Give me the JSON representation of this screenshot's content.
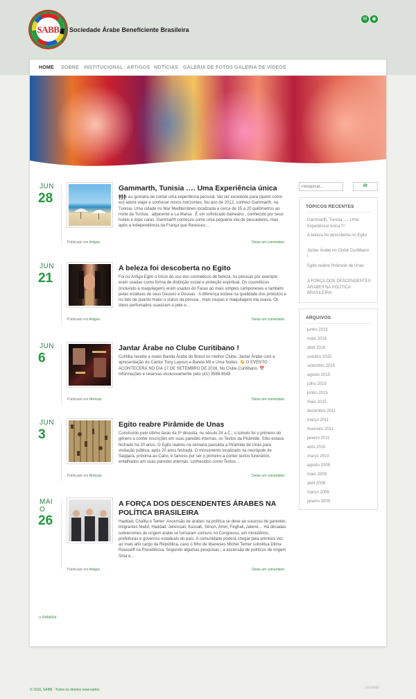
{
  "site": {
    "logo_text": "SABB",
    "title": "Sociedade Árabe Beneficiente Brasileira"
  },
  "social": [
    {
      "icon": "email-icon",
      "glyph": "✉"
    },
    {
      "icon": "rss-icon",
      "glyph": "◉"
    }
  ],
  "nav": [
    "HOME",
    "SOBRE",
    "INSTITUCIONAL",
    "ARTIGOS",
    "NOTÍCIAS",
    "GALERIA DE FOTOS",
    "GALERIA DE VÍDEOS"
  ],
  "posts": [
    {
      "month": "JUN",
      "day": "28",
      "title": "Gammarth, Tunisia …. Uma Experiência única !!!",
      "excerpt": "Hoje eu gostaria de contar uma experiência pessoal. Vai ser excelente para (quem como eu) adora viajar e conhecer novos horizontes. No ano de 2012, conheci Gammarth, na Tunisia. Uma cidade no Mar Mediterrâneo localizada a cerca de 15 a 20 quilômetros ao norte da Tunisia , adjacente a La Marsa . É um sofisticado balneário , conhecido por seus hotéis e lojas caras. Gammarth começou como uma pequena vila de pescadores, mas após a independência da França que floresceu…",
      "meta_prefix": "Publicado em",
      "category": "Artigos",
      "comment": "Deixe um comentário"
    },
    {
      "month": "JUN",
      "day": "21",
      "title": "A beleza foi descoberta no Egito",
      "excerpt": "Foi no Antigo Egito o início do uso dos cosméticos de beleza. As perucas por exemplo eram usadas como forma de distinção social e proteção espiritual. Os cosméticos (incluindo a maquilagem) eram usados do Farao ao mais simples camponeses e também pelas estátuas de seus Deuses e Deusas . A diferença estava na qualidade dos produtos e no fato de quanto maior o status da pessoa , mais roupas e maquilagem ela usava. Os óleos perfumados suavizam a pele e…",
      "meta_prefix": "Publicado em",
      "category": "Artigos",
      "comment": "Deixe um comentário"
    },
    {
      "month": "JUN",
      "day": "6",
      "title": "Jantar Árabe no Clube Curitibano !",
      "excerpt": "Curitiba recebe a maior Banda Árabe do Brasil no melhor Clube. Jantar Árabe com a apresentação do Cantor Tony Layoun e Banda Mil e Uma Noites. 👋 O EVENTO ACONTECERÁ NO DIA 17 DE SETEMBRO DE 2016, No Clube Curitibano. 📅 Informações e reservas exclusivamente pelo (41) 3598-9548",
      "meta_prefix": "Publicado em",
      "category": "Notícias",
      "comment": "Deixe um comentário"
    },
    {
      "month": "JUN",
      "day": "3",
      "title": "Egito reabre Pirâmide de Unas",
      "excerpt": "Construído pelo último farao da 5ª dinastia, no século 24 a.C., o túmulo foi o primeiro do gênero a conter inscrições em suas paredes internas, os Textos da Pirâmide. Sítio estava fechado há 20 anos. O Egito reabriu na semana passada a Pirâmide de Unas para visitação pública, após 20 anos fechada. O monumento localizado na necrópole de Saqqara, próxima ao Cairo, é famoso por ser o primeiro a conter textos funerários entalhados em suas paredes internas, conhecidos como Textos…",
      "meta_prefix": "Publicado em",
      "category": "Notícias",
      "comment": "Deixe um comentário"
    },
    {
      "month": "MAIO",
      "day": "26",
      "title": "A FORÇA DOS DESCENDENTES ÁRABES NA POLÍTICA BRASILEIRA",
      "excerpt": "Haddad, Chalita e Temer: Ascensão de árabes na política se deve ao sucesso de parentes imigrantes Maluf, Haddad, Jereissati, Kassab, Simon, Amin, Feghali, Jatene… Há décadas sobrenomes de origem árabe se tornaram comuns no Congresso, em ministérios, prefeituras e governos estaduais do país. A comunidade poderá chegar pela primeira vez ao mais alto cargo da República, caso o filho de libaneses Michel Temer substitua Dilma Rousseff na Presidência. Segundo algumas pesquisas , a ascensão de políticos de origem Síria e…",
      "meta_prefix": "Publicado em",
      "category": "Artigos",
      "comment": "Deixe um comentário"
    }
  ],
  "pagination": {
    "previous": "« Anterior"
  },
  "search": {
    "placeholder": "Pesquisar...",
    "button": "IR"
  },
  "recent": {
    "title": "TÓPICOS RECENTES",
    "items": [
      "Gammarth, Tunisia …. Uma Experiência única !!!",
      "A beleza foi descoberta no Egito",
      "Jantar Árabe no Clube Curitibano !",
      "Egito reabre Pirâmide de Unas",
      "A FORÇA DOS DESCENDENTES ÁRABES NA POLÍTICA BRASILEIRA"
    ]
  },
  "archives": {
    "title": "ARQUIVOS",
    "items": [
      "junho 2016",
      "maio 2016",
      "abril 2016",
      "outubro 2015",
      "setembro 2015",
      "agosto 2015",
      "julho 2015",
      "junho 2015",
      "maio 2015",
      "dezembro 2011",
      "março 2011",
      "fevereiro 2011",
      "janeiro 2011",
      "abril 2010",
      "março 2010",
      "agosto 2009",
      "maio 2009",
      "abril 2009",
      "março 2009",
      "janeiro 2009"
    ]
  },
  "footer": {
    "copyright": "© 2016, SABB - Todos os direitos reservados",
    "credit": "mcweb"
  },
  "colors": {
    "accent": "#1f9a3b",
    "header_band": "#dde1dc",
    "background": "#efefec"
  }
}
